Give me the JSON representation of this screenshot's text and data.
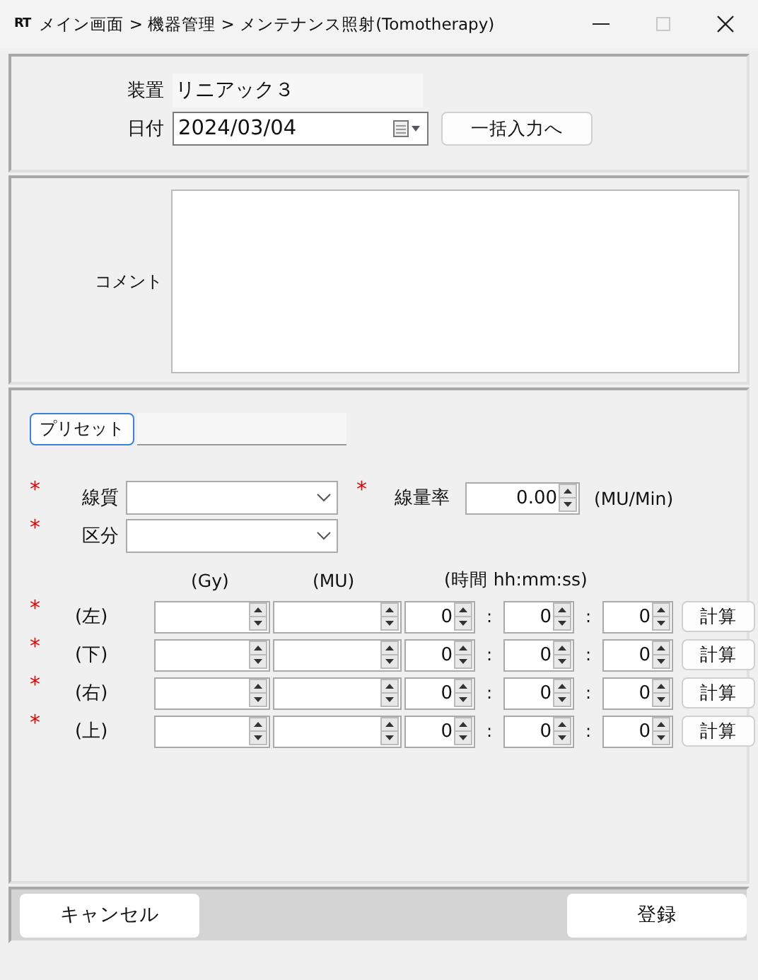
{
  "window": {
    "logo": "RT",
    "title": "メイン画面 > 機器管理 > メンテナンス照射(Tomotherapy)",
    "maximize_disabled": true
  },
  "device": {
    "label": "装置",
    "value": "リニアック３"
  },
  "date": {
    "label": "日付",
    "value": "2024/03/04"
  },
  "bulk_button": "一括入力へ",
  "comment": {
    "label": "コメント"
  },
  "preset": {
    "button": "プリセット"
  },
  "beam_quality": {
    "marker": "*",
    "label": "線質"
  },
  "dose_rate": {
    "marker": "*",
    "label": "線量率",
    "value": "0.00",
    "unit": "(MU/Min)"
  },
  "category": {
    "marker": "*",
    "label": "区分"
  },
  "columns": [
    "(Gy)",
    "(MU)",
    "(時間 hh:mm:ss)"
  ],
  "rows": [
    {
      "marker": "*",
      "label": "(左)",
      "time": [
        "0",
        "0",
        "0"
      ],
      "separators": [
        ":",
        ":"
      ],
      "button": "計算"
    },
    {
      "marker": "*",
      "label": "(下)",
      "time": [
        "0",
        "0",
        "0"
      ],
      "separators": [
        ":",
        ":"
      ],
      "button": "計算"
    },
    {
      "marker": "*",
      "label": "(右)",
      "time": [
        "0",
        "0",
        "0"
      ],
      "separators": [
        ":",
        ":"
      ],
      "button": "計算"
    },
    {
      "marker": "*",
      "label": "(上)",
      "time": [
        "0",
        "0",
        "0"
      ],
      "separators": [
        ":",
        ":"
      ],
      "button": "計算"
    }
  ],
  "footer": {
    "cancel": "キャンセル",
    "submit": "登録"
  }
}
